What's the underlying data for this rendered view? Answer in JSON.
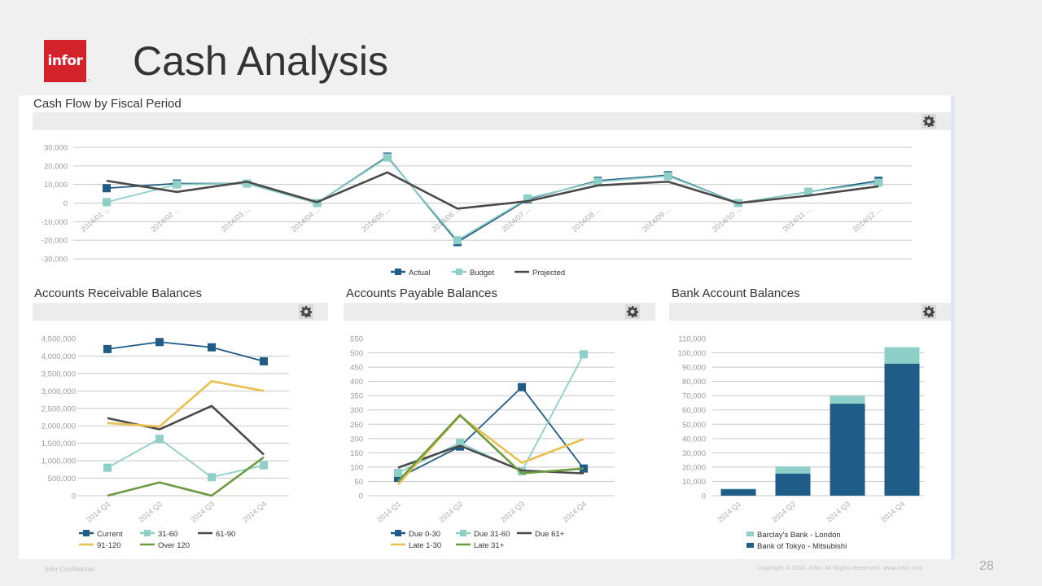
{
  "header": {
    "logo_text": "infor",
    "logo_tm": "™",
    "title": "Cash Analysis"
  },
  "footer": {
    "confidential": "Infor Confidential",
    "copyright": "Copyright © 2016. Infor. All Rights Reserved. www.infor.com",
    "page_number": "28"
  },
  "colors": {
    "brand_red": "#d3222a",
    "dark_blue": "#1f5c87",
    "teal": "#8ecfc7",
    "dark_gray": "#4a4a4a",
    "gold": "#e9bf4f",
    "green": "#6b9b3e"
  },
  "icons": {
    "gear": "gear-icon"
  },
  "chart_data": [
    {
      "id": "cashflow",
      "type": "line",
      "title": "Cash Flow by Fiscal Period",
      "categories": [
        "2014/01 ...",
        "2014/02 ...",
        "2014/03 ...",
        "2014/04 ...",
        "2014/05 ...",
        "2014/06 ...",
        "2014/07 ...",
        "2014/08 ...",
        "2014/09 ...",
        "2014/10 ...",
        "2014/11 ...",
        "2014/12 ..."
      ],
      "ylim": [
        -30000,
        30000
      ],
      "yticks": [
        30000,
        20000,
        10000,
        0,
        -10000,
        -20000,
        -30000
      ],
      "ytick_labels": [
        "30,000",
        "20,000",
        "10,000",
        "0",
        "-10,000",
        "-20,000",
        "-30,000"
      ],
      "grid": true,
      "legend": "bottom",
      "series": [
        {
          "name": "Actual",
          "color": "#1f5c87",
          "marker": true,
          "values": [
            8000,
            10500,
            10500,
            0,
            25000,
            -21000,
            2000,
            12000,
            15000,
            0,
            6000,
            12000
          ]
        },
        {
          "name": "Budget",
          "color": "#8ecfc7",
          "marker": true,
          "values": [
            500,
            10000,
            10500,
            0,
            24500,
            -20000,
            2500,
            11500,
            14500,
            0,
            6000,
            11000
          ]
        },
        {
          "name": "Projected",
          "color": "#4a4a4a",
          "marker": false,
          "values": [
            12000,
            6000,
            11500,
            500,
            16500,
            -3000,
            1000,
            9500,
            11500,
            0,
            4000,
            9000
          ]
        }
      ]
    },
    {
      "id": "ar",
      "type": "line",
      "title": "Accounts Receivable Balances",
      "categories": [
        "2014 Q1",
        "2014 Q2",
        "2014 Q3",
        "2014 Q4"
      ],
      "ylim": [
        0,
        4500000
      ],
      "yticks": [
        4500000,
        4000000,
        3500000,
        3000000,
        2500000,
        2000000,
        1500000,
        1000000,
        500000,
        0
      ],
      "ytick_labels": [
        "4,500,000",
        "4,000,000",
        "3,500,000",
        "3,000,000",
        "2,500,000",
        "2,000,000",
        "1,500,000",
        "1,000,000",
        "500,000",
        "0"
      ],
      "grid": true,
      "legend": "bottom",
      "series": [
        {
          "name": "Current",
          "color": "#1f5c87",
          "marker": true,
          "values": [
            4200000,
            4400000,
            4250000,
            3850000
          ]
        },
        {
          "name": "31-60",
          "color": "#8ecfc7",
          "marker": true,
          "values": [
            800000,
            1630000,
            530000,
            870000
          ]
        },
        {
          "name": "61-90",
          "color": "#4a4a4a",
          "marker": false,
          "values": [
            2220000,
            1900000,
            2570000,
            1180000
          ]
        },
        {
          "name": "91-120",
          "color": "#e9bf4f",
          "marker": false,
          "values": [
            2080000,
            1980000,
            3280000,
            3000000
          ]
        },
        {
          "name": "Over 120",
          "color": "#6b9b3e",
          "marker": false,
          "values": [
            0,
            380000,
            0,
            1100000
          ]
        }
      ]
    },
    {
      "id": "ap",
      "type": "line",
      "title": "Accounts Payable Balances",
      "categories": [
        "2014 Q1",
        "2014 Q2",
        "2014 Q3",
        "2014 Q4"
      ],
      "ylim": [
        0,
        550
      ],
      "yticks": [
        550,
        500,
        450,
        400,
        350,
        300,
        250,
        200,
        150,
        100,
        50,
        0
      ],
      "ytick_labels": [
        "550",
        "500",
        "450",
        "400",
        "350",
        "300",
        "250",
        "200",
        "150",
        "100",
        "50",
        "0"
      ],
      "grid": true,
      "legend": "bottom",
      "series": [
        {
          "name": "Due 0-30",
          "color": "#1f5c87",
          "marker": true,
          "values": [
            62,
            172,
            380,
            95
          ]
        },
        {
          "name": "Due 31-60",
          "color": "#8ecfc7",
          "marker": true,
          "values": [
            80,
            185,
            85,
            495
          ]
        },
        {
          "name": "Due 61+",
          "color": "#4a4a4a",
          "marker": false,
          "values": [
            98,
            175,
            88,
            78
          ]
        },
        {
          "name": "Late 1-30",
          "color": "#e9bf4f",
          "marker": false,
          "values": [
            40,
            280,
            115,
            198
          ]
        },
        {
          "name": "Late 31+",
          "color": "#6b9b3e",
          "marker": false,
          "values": [
            50,
            282,
            78,
            95
          ]
        }
      ]
    },
    {
      "id": "bank",
      "type": "bar",
      "stacked": true,
      "title": "Bank Account Balances",
      "categories": [
        "2014 Q1",
        "2014 Q2",
        "2014 Q3",
        "2014 Q4"
      ],
      "ylim": [
        0,
        110000
      ],
      "yticks": [
        110000,
        100000,
        90000,
        80000,
        70000,
        60000,
        50000,
        40000,
        30000,
        20000,
        10000,
        0
      ],
      "ytick_labels": [
        "110,000",
        "100,000",
        "90,000",
        "80,000",
        "70,000",
        "60,000",
        "50,000",
        "40,000",
        "30,000",
        "20,000",
        "10,000",
        "0"
      ],
      "grid": true,
      "legend": "bottom",
      "series": [
        {
          "name": "Bank of Tokyo - Mitsubishi",
          "color": "#1f5c87",
          "values": [
            4500,
            15500,
            64500,
            92500
          ]
        },
        {
          "name": "Barclay's Bank - London",
          "color": "#8ecfc7",
          "values": [
            1000,
            5500,
            6000,
            12000
          ]
        }
      ],
      "legend_order": [
        "Barclay's Bank - London",
        "Bank of Tokyo - Mitsubishi"
      ]
    }
  ]
}
